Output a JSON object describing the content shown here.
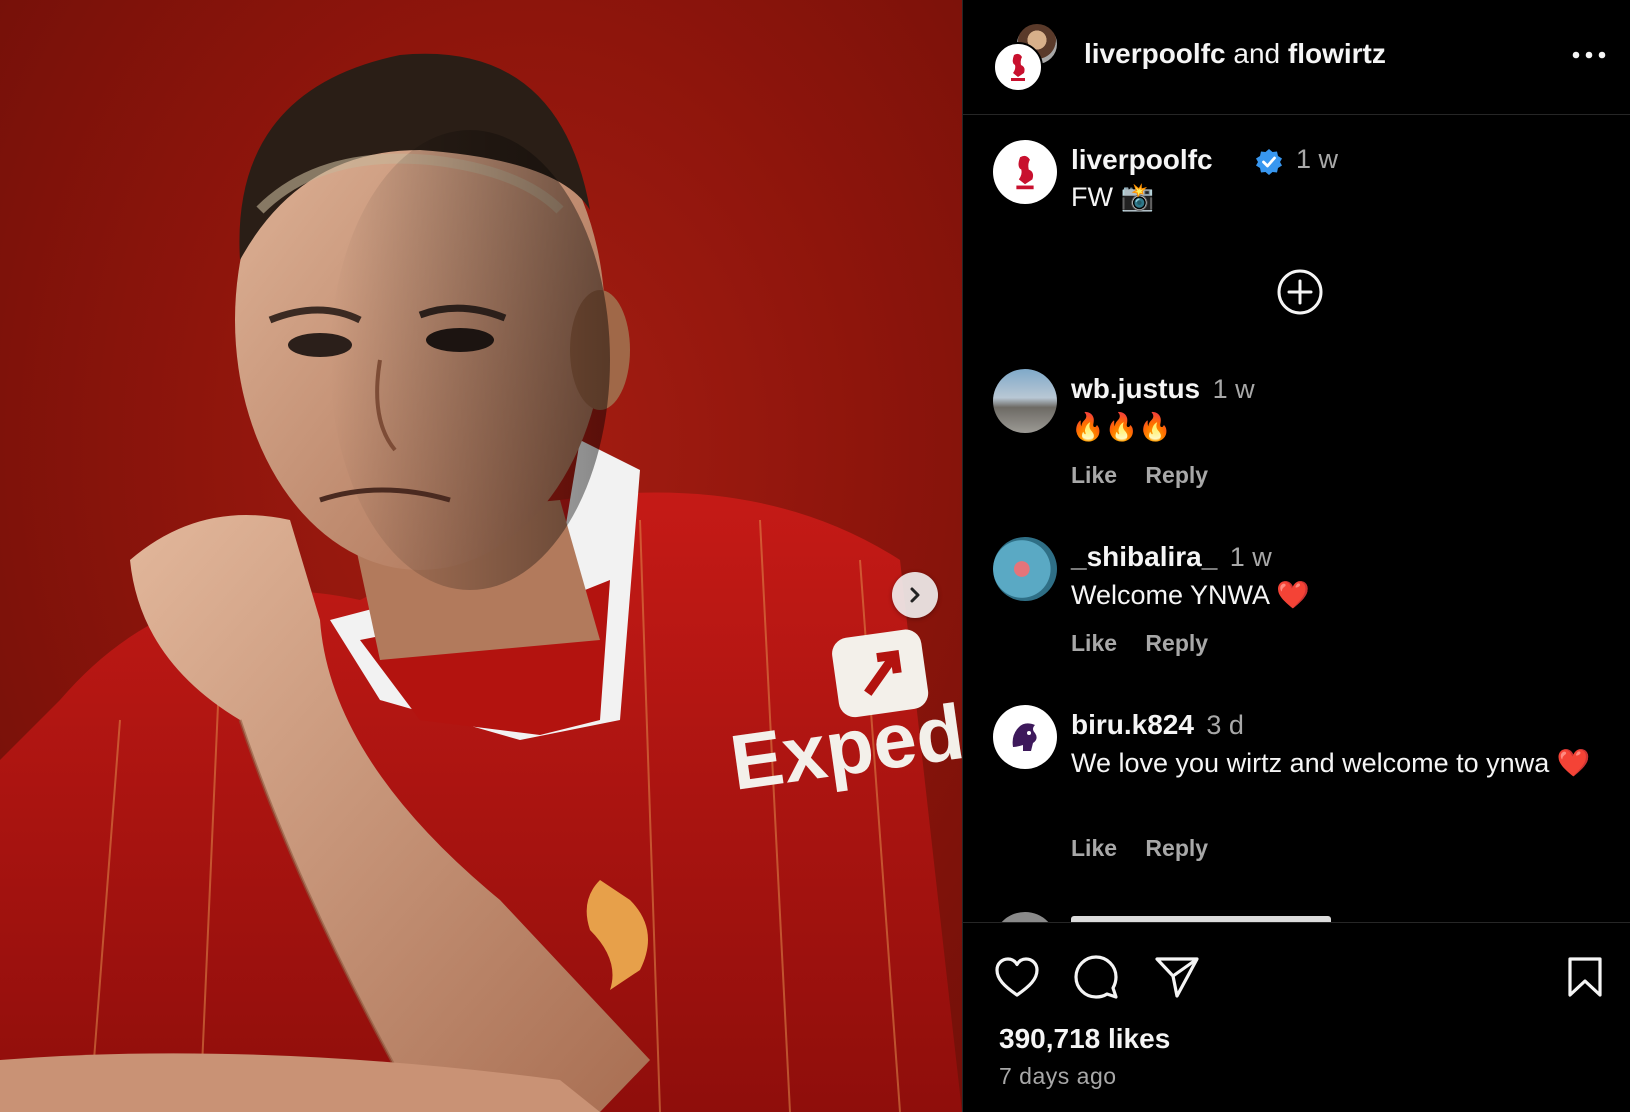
{
  "header": {
    "account1": "liverpoolfc",
    "joiner": "and",
    "account2": "flowirtz"
  },
  "caption": {
    "username": "liverpoolfc",
    "time": "1 w",
    "text": "FW 📸"
  },
  "comments": [
    {
      "username": "wb.justus",
      "time": "1 w",
      "text": "🔥🔥🔥",
      "like": "Like",
      "reply": "Reply"
    },
    {
      "username": "_shibalira_",
      "time": "1 w",
      "text": "Welcome YNWA ❤️",
      "like": "Like",
      "reply": "Reply"
    },
    {
      "username": "biru.k824",
      "time": "3 d",
      "text": "We love you wirtz and welcome to ynwa ❤️",
      "like": "Like",
      "reply": "Reply"
    }
  ],
  "footer": {
    "likes": "390,718 likes",
    "date": "7 days ago"
  },
  "media": {
    "sponsor_text": "Expedia"
  },
  "colors": {
    "background": "#000000",
    "secondary_text": "#a8a8a8",
    "verified": "#3897f0",
    "divider": "#262626",
    "club_red": "#c8102e"
  }
}
